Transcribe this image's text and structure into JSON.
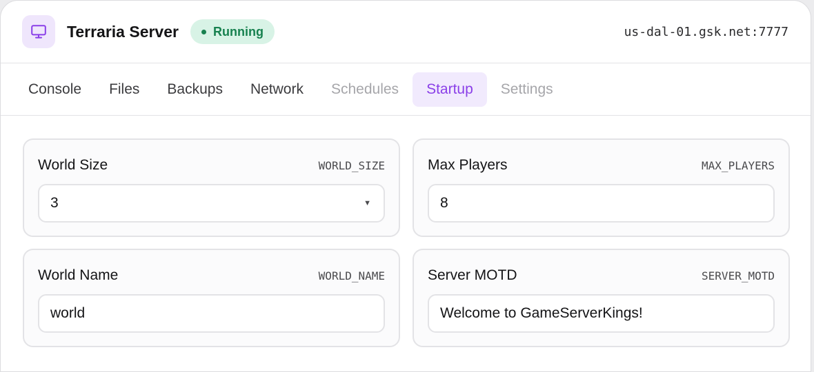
{
  "header": {
    "title": "Terraria Server",
    "status": "Running",
    "address": "us-dal-01.gsk.net:7777",
    "icon": "monitor-icon"
  },
  "colors": {
    "accent": "#8a3fe8",
    "status_bg": "#d8f3e6",
    "status_text": "#17814f"
  },
  "tabs": [
    {
      "label": "Console",
      "state": "normal"
    },
    {
      "label": "Files",
      "state": "normal"
    },
    {
      "label": "Backups",
      "state": "normal"
    },
    {
      "label": "Network",
      "state": "normal"
    },
    {
      "label": "Schedules",
      "state": "disabled"
    },
    {
      "label": "Startup",
      "state": "active"
    },
    {
      "label": "Settings",
      "state": "disabled"
    }
  ],
  "fields": {
    "world_size": {
      "label": "World Size",
      "env": "WORLD_SIZE",
      "value": "3",
      "type": "select"
    },
    "max_players": {
      "label": "Max Players",
      "env": "MAX_PLAYERS",
      "value": "8",
      "type": "text"
    },
    "world_name": {
      "label": "World Name",
      "env": "WORLD_NAME",
      "value": "world",
      "type": "text"
    },
    "server_motd": {
      "label": "Server MOTD",
      "env": "SERVER_MOTD",
      "value": "Welcome to GameServerKings!",
      "type": "text"
    }
  }
}
